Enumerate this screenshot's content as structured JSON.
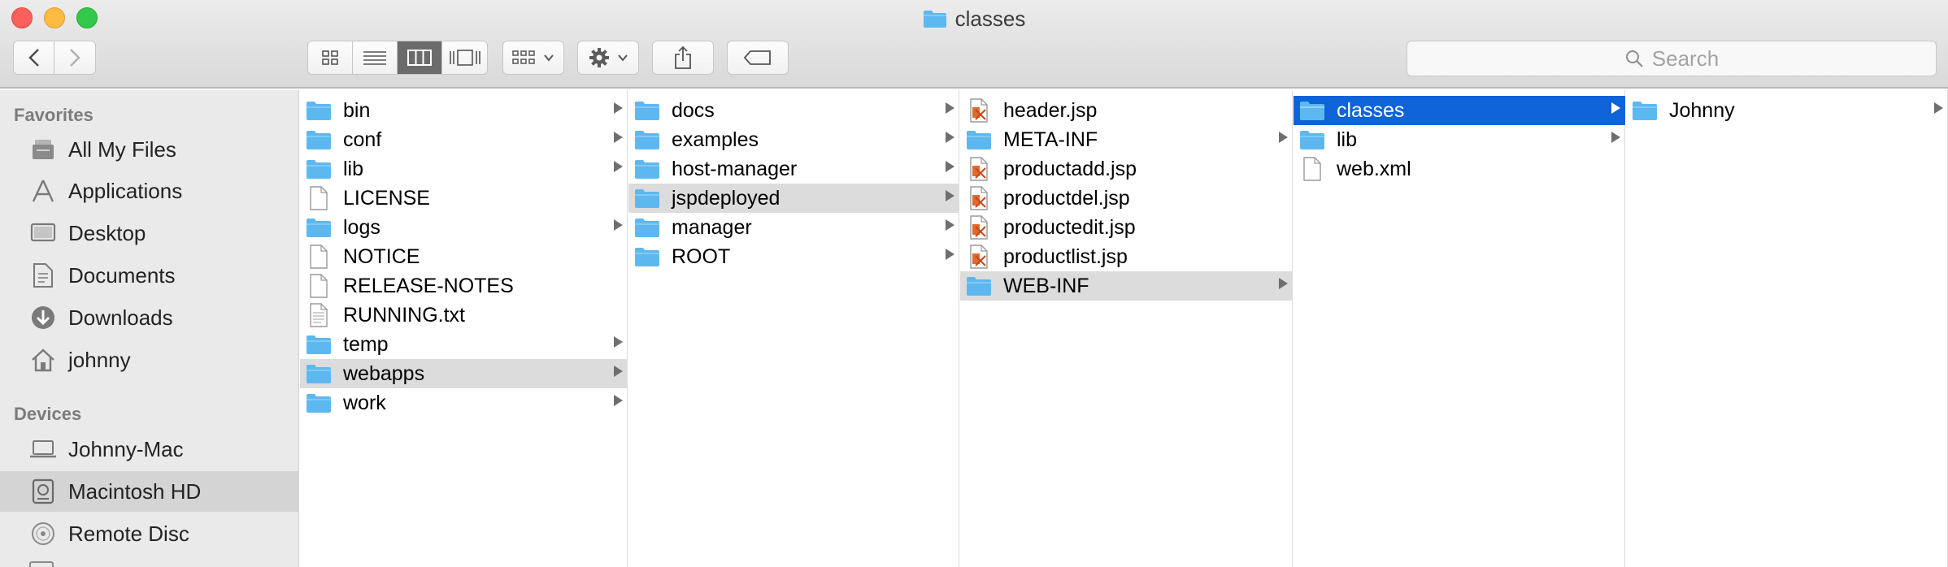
{
  "window": {
    "title": "Classes",
    "title_display": "classes"
  },
  "toolbar": {
    "back": "back",
    "forward": "forward",
    "views": [
      "icon-view",
      "list-view",
      "column-view",
      "cover-flow-view"
    ],
    "active_view": "column-view",
    "search_placeholder": "Search"
  },
  "sidebar": {
    "favorites_heading": "Favorites",
    "favorites": [
      {
        "label": "All My Files",
        "icon": "all-files-icon"
      },
      {
        "label": "Applications",
        "icon": "applications-icon"
      },
      {
        "label": "Desktop",
        "icon": "desktop-icon"
      },
      {
        "label": "Documents",
        "icon": "documents-icon"
      },
      {
        "label": "Downloads",
        "icon": "downloads-icon"
      },
      {
        "label": "johnny",
        "icon": "home-icon"
      }
    ],
    "devices_heading": "Devices",
    "devices": [
      {
        "label": "Johnny-Mac",
        "icon": "laptop-icon"
      },
      {
        "label": "Macintosh HD",
        "icon": "hard-disk-icon",
        "selected": true
      },
      {
        "label": "Remote Disc",
        "icon": "remote-disc-icon"
      }
    ]
  },
  "columns": [
    {
      "items": [
        {
          "name": "bin",
          "type": "folder"
        },
        {
          "name": "conf",
          "type": "folder"
        },
        {
          "name": "lib",
          "type": "folder"
        },
        {
          "name": "LICENSE",
          "type": "file"
        },
        {
          "name": "logs",
          "type": "folder"
        },
        {
          "name": "NOTICE",
          "type": "file"
        },
        {
          "name": "RELEASE-NOTES",
          "type": "file"
        },
        {
          "name": "RUNNING.txt",
          "type": "text"
        },
        {
          "name": "temp",
          "type": "folder"
        },
        {
          "name": "webapps",
          "type": "folder",
          "selected": "grey"
        },
        {
          "name": "work",
          "type": "folder"
        }
      ]
    },
    {
      "items": [
        {
          "name": "docs",
          "type": "folder"
        },
        {
          "name": "examples",
          "type": "folder"
        },
        {
          "name": "host-manager",
          "type": "folder"
        },
        {
          "name": "jspdeployed",
          "type": "folder",
          "selected": "grey"
        },
        {
          "name": "manager",
          "type": "folder"
        },
        {
          "name": "ROOT",
          "type": "folder"
        }
      ]
    },
    {
      "items": [
        {
          "name": "header.jsp",
          "type": "jsp"
        },
        {
          "name": "META-INF",
          "type": "folder"
        },
        {
          "name": "productadd.jsp",
          "type": "jsp"
        },
        {
          "name": "productdel.jsp",
          "type": "jsp"
        },
        {
          "name": "productedit.jsp",
          "type": "jsp"
        },
        {
          "name": "productlist.jsp",
          "type": "jsp"
        },
        {
          "name": "WEB-INF",
          "type": "folder",
          "selected": "grey"
        }
      ]
    },
    {
      "items": [
        {
          "name": "classes",
          "type": "folder",
          "selected": "blue"
        },
        {
          "name": "lib",
          "type": "folder"
        },
        {
          "name": "web.xml",
          "type": "file"
        }
      ]
    },
    {
      "items": [
        {
          "name": "Johnny",
          "type": "folder"
        }
      ]
    }
  ],
  "colors": {
    "selection_blue": "#0f63d9",
    "selection_grey": "#dcdcdc",
    "folder": "#5db8f0"
  }
}
